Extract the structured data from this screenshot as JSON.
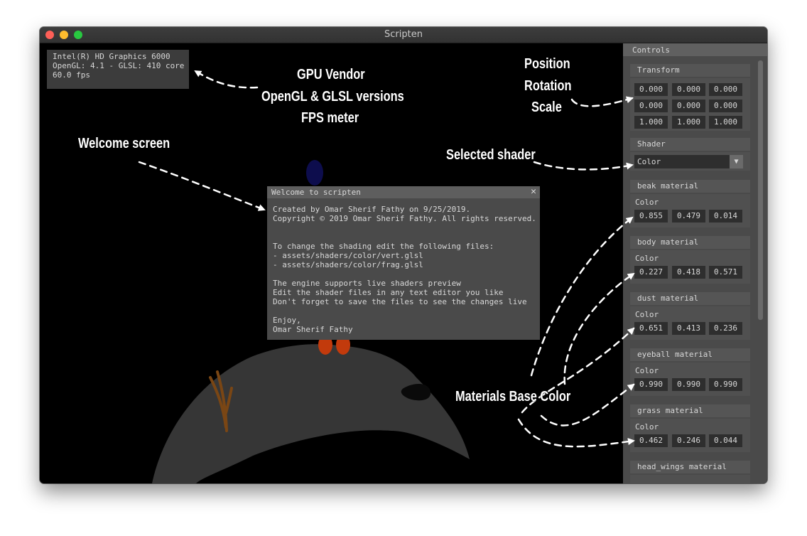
{
  "window": {
    "title": "Scripten"
  },
  "info_overlay": {
    "lines": [
      "Intel(R) HD Graphics 6000",
      "OpenGL: 4.1 - GLSL: 410 core",
      "60.0 fps"
    ]
  },
  "welcome": {
    "title": "Welcome to scripten",
    "close": "✕",
    "lines": [
      "Created by Omar Sherif Fathy on 9/25/2019.",
      "Copyright © 2019 Omar Sherif Fathy. All rights reserved.",
      "",
      "",
      "To change the shading edit the following files:",
      "- assets/shaders/color/vert.glsl",
      "- assets/shaders/color/frag.glsl",
      "",
      "The engine supports live shaders preview",
      "Edit the shader files in any text editor you like",
      "Don't forget to save the files to see the changes live",
      "",
      "Enjoy,",
      "Omar Sherif Fathy"
    ]
  },
  "controls": {
    "title": "Controls",
    "transform": {
      "label": "Transform",
      "position": [
        "0.000",
        "0.000",
        "0.000"
      ],
      "rotation": [
        "0.000",
        "0.000",
        "0.000"
      ],
      "scale": [
        "1.000",
        "1.000",
        "1.000"
      ]
    },
    "shader": {
      "label": "Shader",
      "selected": "Color",
      "arrow": "▼"
    },
    "color_label": "Color",
    "materials": [
      {
        "name": "beak material",
        "color": [
          "0.855",
          "0.479",
          "0.014"
        ]
      },
      {
        "name": "body material",
        "color": [
          "0.227",
          "0.418",
          "0.571"
        ]
      },
      {
        "name": "dust material",
        "color": [
          "0.651",
          "0.413",
          "0.236"
        ]
      },
      {
        "name": "eyeball material",
        "color": [
          "0.990",
          "0.990",
          "0.990"
        ]
      },
      {
        "name": "grass material",
        "color": [
          "0.462",
          "0.246",
          "0.044"
        ]
      },
      {
        "name": "head_wings material"
      }
    ]
  },
  "annotations": {
    "gpu": [
      "GPU Vendor",
      "OpenGL & GLSL versions",
      "FPS meter"
    ],
    "welcome": "Welcome screen",
    "transform": [
      "Position",
      "Rotation",
      "Scale"
    ],
    "shader": "Selected shader",
    "materials": "Materials Base Color"
  },
  "colors": {
    "background": "#000000",
    "panel": "#4a4a4a",
    "field": "#2e2e2e",
    "rock": "#363636",
    "beak": "#c23a0c",
    "head": "#0d0d4d",
    "grass": "#7a4614"
  }
}
